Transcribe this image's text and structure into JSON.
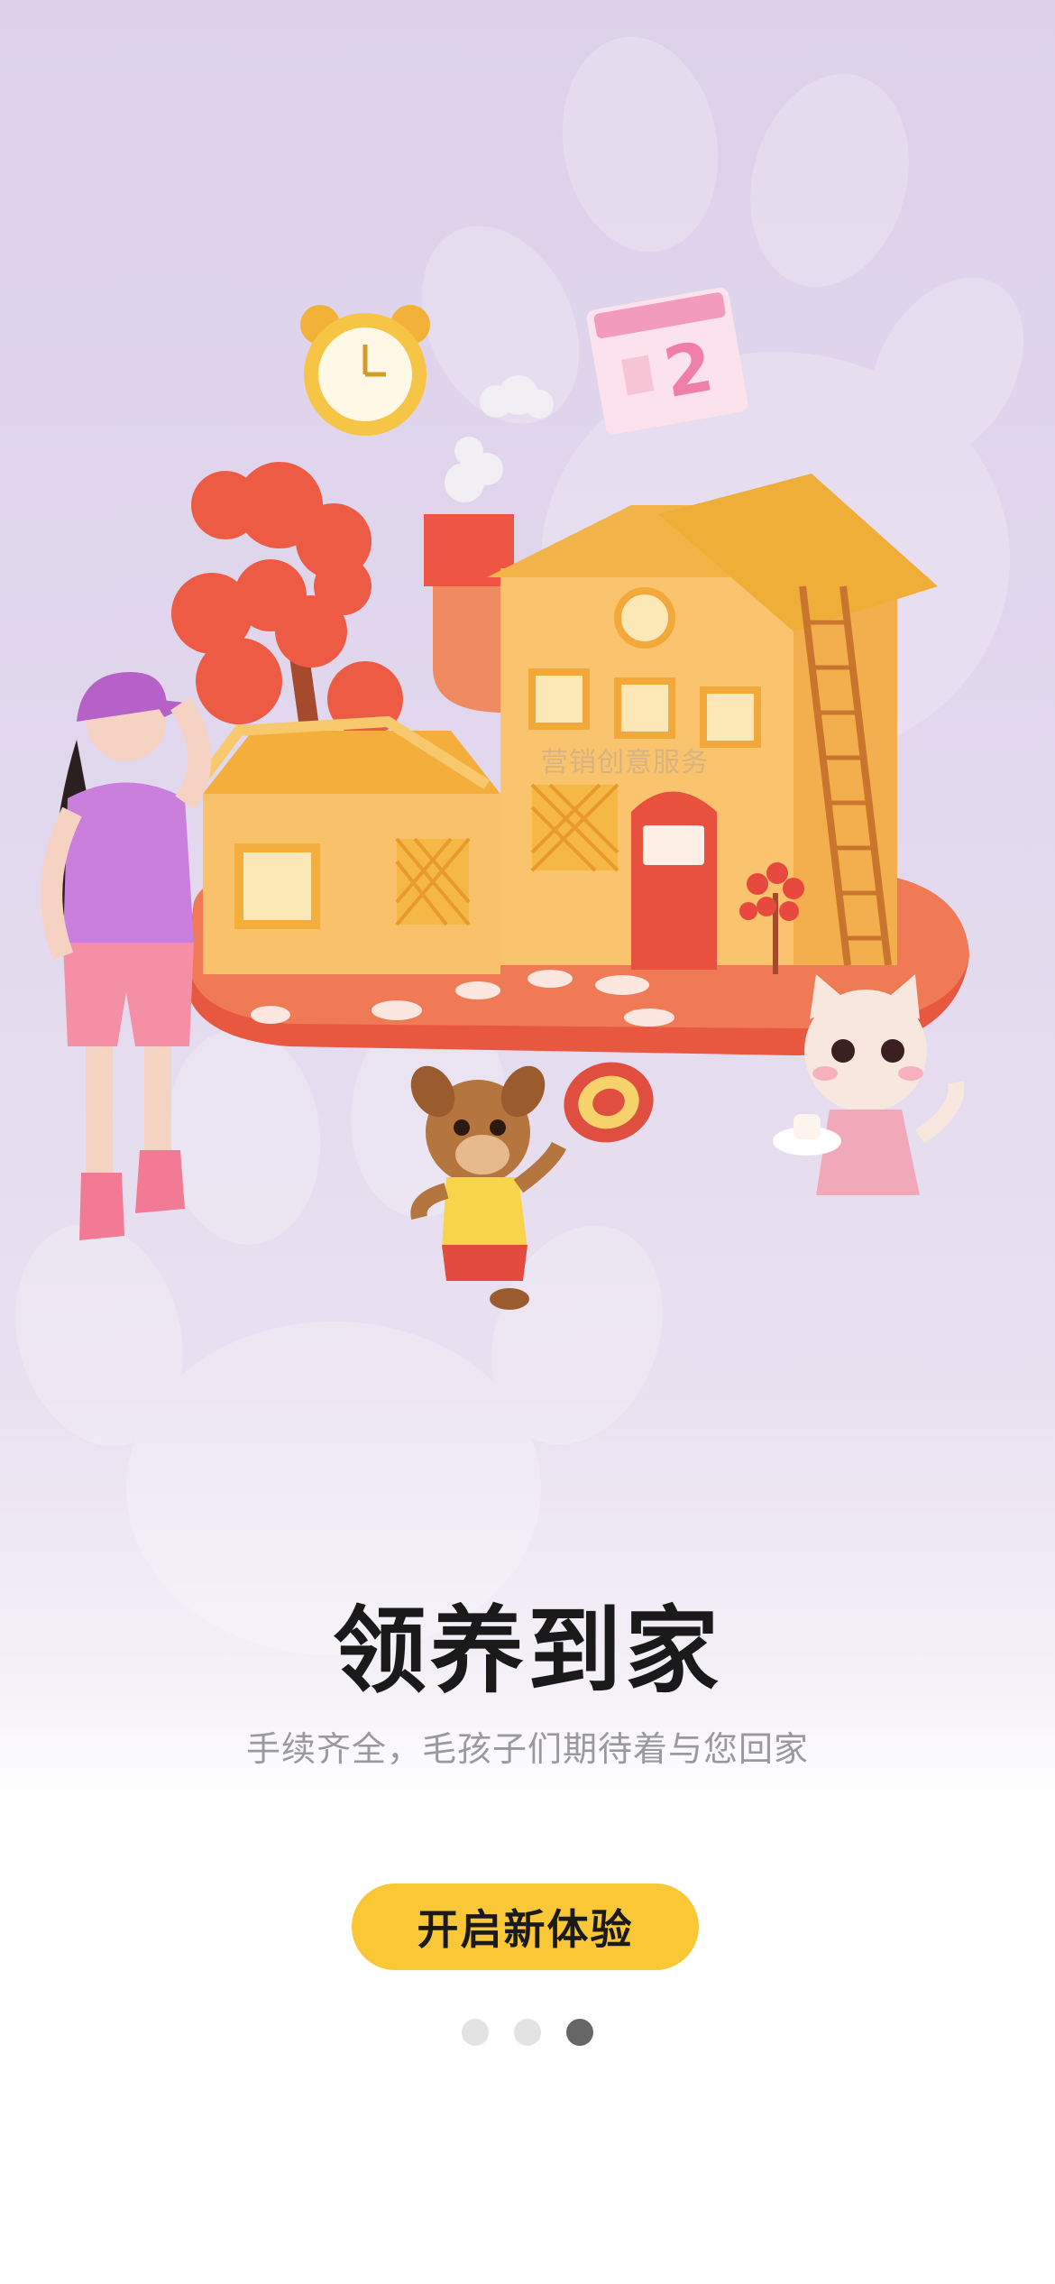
{
  "onboarding": {
    "title": "领养到家",
    "subtitle": "手续齐全，毛孩子们期待着与您回家",
    "start_button_label": "开启新体验",
    "watermark_text": "营销创意服务",
    "calendar_number": "2",
    "page_count": 3,
    "active_page": 3
  },
  "colors": {
    "background_top": "#DCD1E9",
    "button": "#FAC737",
    "dot_inactive": "#E3E3E3",
    "dot_active": "#666666",
    "title": "#1A1A1A",
    "subtitle": "#9A9A9A"
  }
}
